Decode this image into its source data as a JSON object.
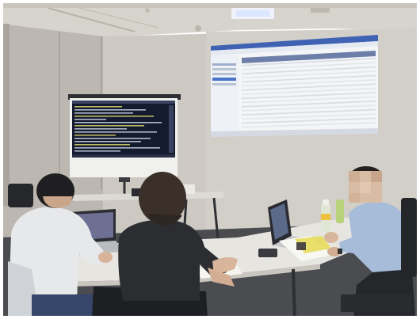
{
  "scene": {
    "colors": {
      "ceiling": "#d9d6cf",
      "wall": "#cfcbc4",
      "left_wall": "#bdb9b2",
      "carpet": "#4b4d51",
      "table": "#e8e6e0",
      "projection": "#f4f6f8",
      "projection_header": "#3d5fb0",
      "terminal_bg": "#141a2e",
      "shirt_left": "#e8eaec",
      "shirt_right": "#9fb6d6",
      "shirt_middle": "#2b2c30",
      "hair": "#2a2220"
    }
  }
}
